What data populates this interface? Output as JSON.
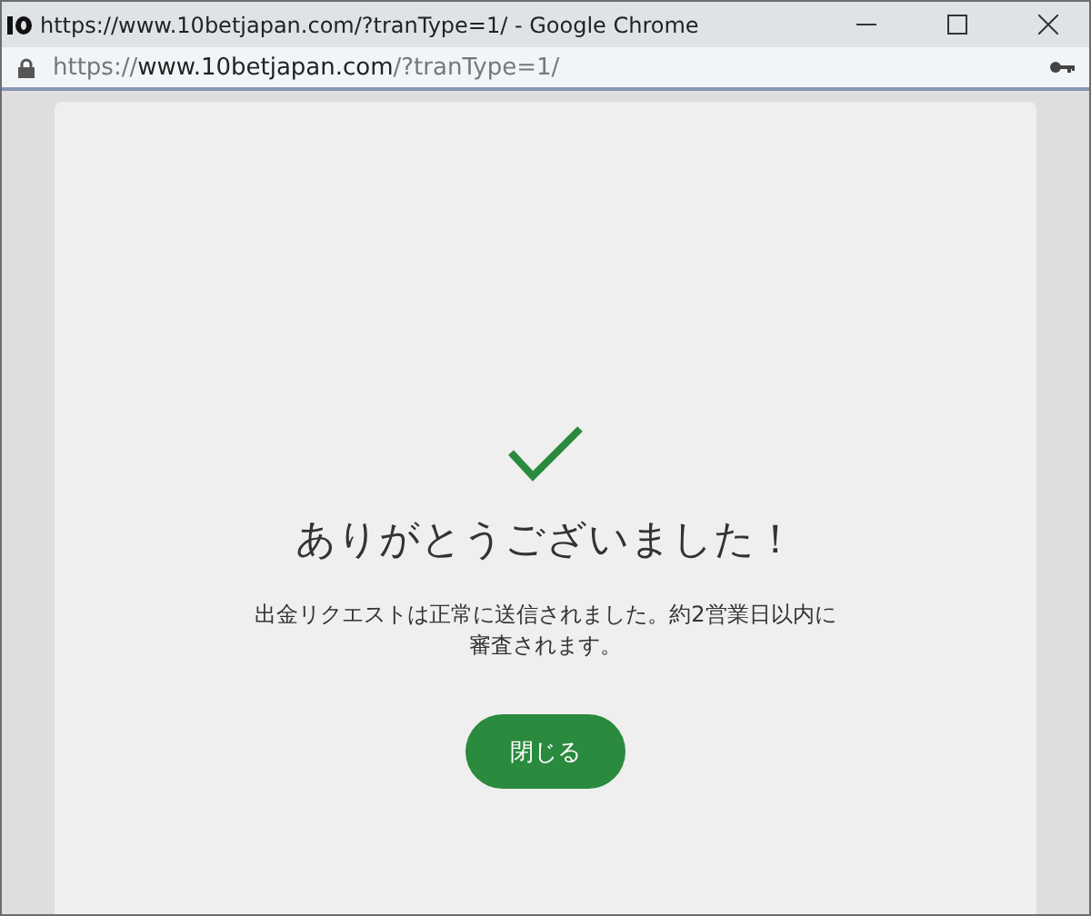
{
  "window": {
    "title": "https://www.10betjapan.com/?tranType=1/ - Google Chrome"
  },
  "address_bar": {
    "scheme": "https://",
    "host": "www.10betjapan.com",
    "path": "/?tranType=1/"
  },
  "dialog": {
    "heading": "ありがとうございました！",
    "message": "出金リクエストは正常に送信されました。約2営業日以内に審査されます。",
    "button": "閉じる"
  }
}
